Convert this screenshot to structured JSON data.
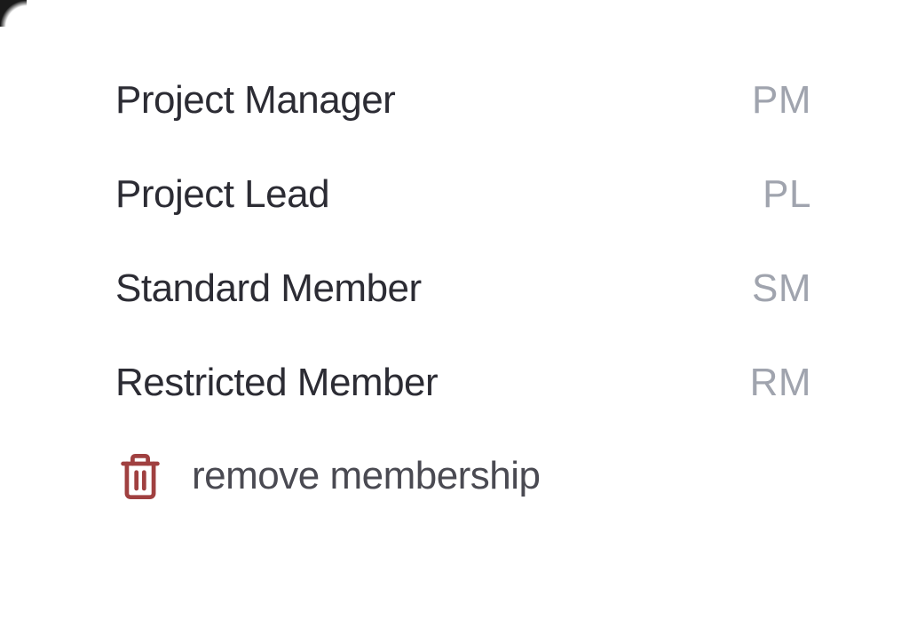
{
  "roles": [
    {
      "label": "Project Manager",
      "abbrev": "PM"
    },
    {
      "label": "Project Lead",
      "abbrev": "PL"
    },
    {
      "label": "Standard Member",
      "abbrev": "SM"
    },
    {
      "label": "Restricted Member",
      "abbrev": "RM"
    }
  ],
  "remove": {
    "label": "remove membership"
  }
}
